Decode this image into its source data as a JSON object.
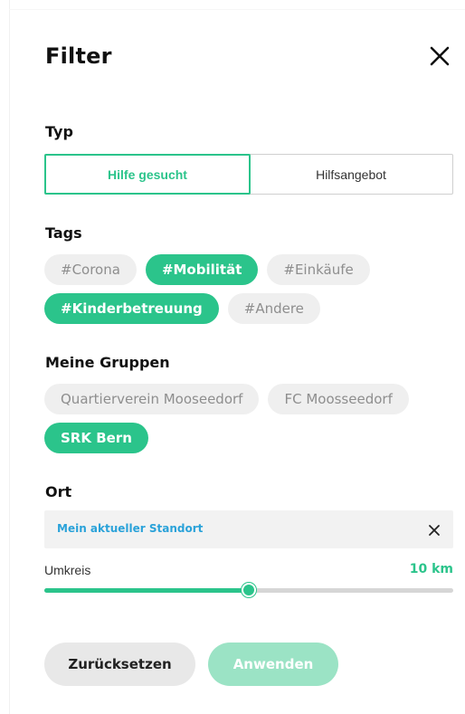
{
  "header": {
    "title": "Filter",
    "close_icon": "close-icon"
  },
  "type_section": {
    "label": "Typ",
    "options": [
      {
        "label": "Hilfe gesucht",
        "selected": true
      },
      {
        "label": "Hilfsangebot",
        "selected": false
      }
    ]
  },
  "tags_section": {
    "label": "Tags",
    "chips": [
      {
        "label": "#Corona",
        "selected": false
      },
      {
        "label": "#Mobilität",
        "selected": true
      },
      {
        "label": "#Einkäufe",
        "selected": false
      },
      {
        "label": "#Kinderbetreuung",
        "selected": true
      },
      {
        "label": "#Andere",
        "selected": false
      }
    ]
  },
  "groups_section": {
    "label": "Meine Gruppen",
    "chips": [
      {
        "label": "Quartierverein Mooseedorf",
        "selected": false
      },
      {
        "label": "FC Moosseedorf",
        "selected": false
      },
      {
        "label": "SRK Bern",
        "selected": true
      }
    ]
  },
  "location_section": {
    "label": "Ort",
    "value": "Mein aktueller Standort",
    "clear_icon": "close-icon"
  },
  "radius": {
    "label": "Umkreis",
    "value_text": "10 km",
    "level_fraction": 0.5
  },
  "actions": {
    "reset_label": "Zurücksetzen",
    "apply_label": "Anwenden"
  },
  "colors": {
    "accent": "#2bc48b",
    "chip_inactive_bg": "#efefef",
    "chip_inactive_text": "#8e8e8e",
    "link": "#2aa2d9",
    "apply_disabled": "#9be3c5"
  }
}
